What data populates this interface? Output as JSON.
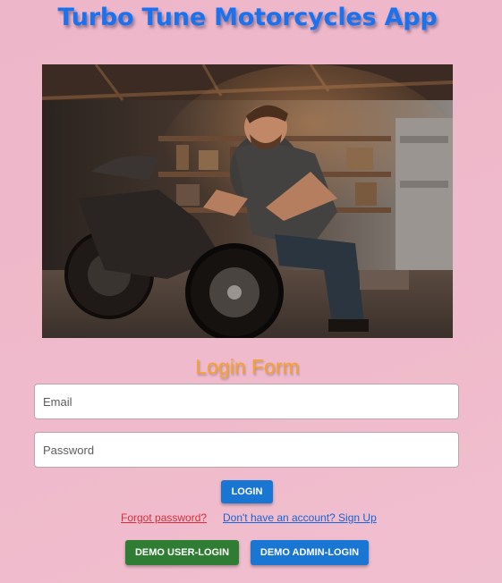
{
  "app": {
    "title": "Turbo Tune Motorcycles App"
  },
  "hero": {
    "image_subject": "mechanic working on motorcycle in garage"
  },
  "login_form": {
    "title": "Login Form",
    "email_placeholder": "Email",
    "password_placeholder": "Password",
    "login_label": "LOGIN",
    "forgot_password_label": "Forgot password?",
    "signup_label": "Don't have an account? Sign Up",
    "demo_user_label": "DEMO USER-LOGIN",
    "demo_admin_label": "DEMO ADMIN-LOGIN"
  },
  "colors": {
    "background": "#efb9ca",
    "title": "#1b72ef",
    "form_title": "#f5a030",
    "primary_button": "#1976d2",
    "success_button": "#2e7d32",
    "forgot_link": "#d4303c",
    "signup_link": "#1a63d0"
  }
}
